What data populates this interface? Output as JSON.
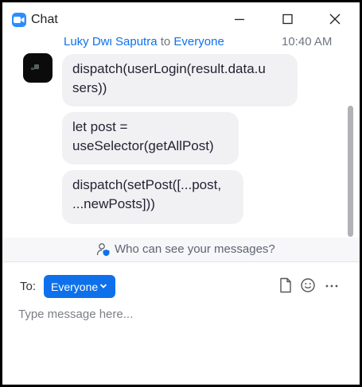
{
  "window": {
    "title": "Chat"
  },
  "icons": {
    "app": "zoom-camera-icon",
    "minimize": "minimize-icon",
    "maximize": "maximize-icon",
    "close": "close-icon",
    "privacy": "user-shield-icon",
    "chevron": "chevron-down-icon",
    "file": "file-icon",
    "emoji": "emoji-icon",
    "more": "more-icon"
  },
  "message_group": {
    "sender": "Luky Dwi Saputra",
    "to_word": "to",
    "recipient": "Everyone",
    "time": "10:40 AM",
    "messages": [
      {
        "line1": "dispatch(userLogin(result.data.u",
        "line2": "sers))"
      },
      {
        "line1": "let post =",
        "line2": "useSelector(getAllPost)"
      },
      {
        "line1": "dispatch(setPost([...post,",
        "line2": "...newPosts]))"
      }
    ]
  },
  "privacy_notice": "Who can see your messages?",
  "composer": {
    "to_label": "To:",
    "recipient": "Everyone",
    "placeholder": "Type message here..."
  },
  "colors": {
    "accent": "#0e71eb",
    "bubble": "#f1f1f4",
    "app_icon": "#2d8cff"
  }
}
